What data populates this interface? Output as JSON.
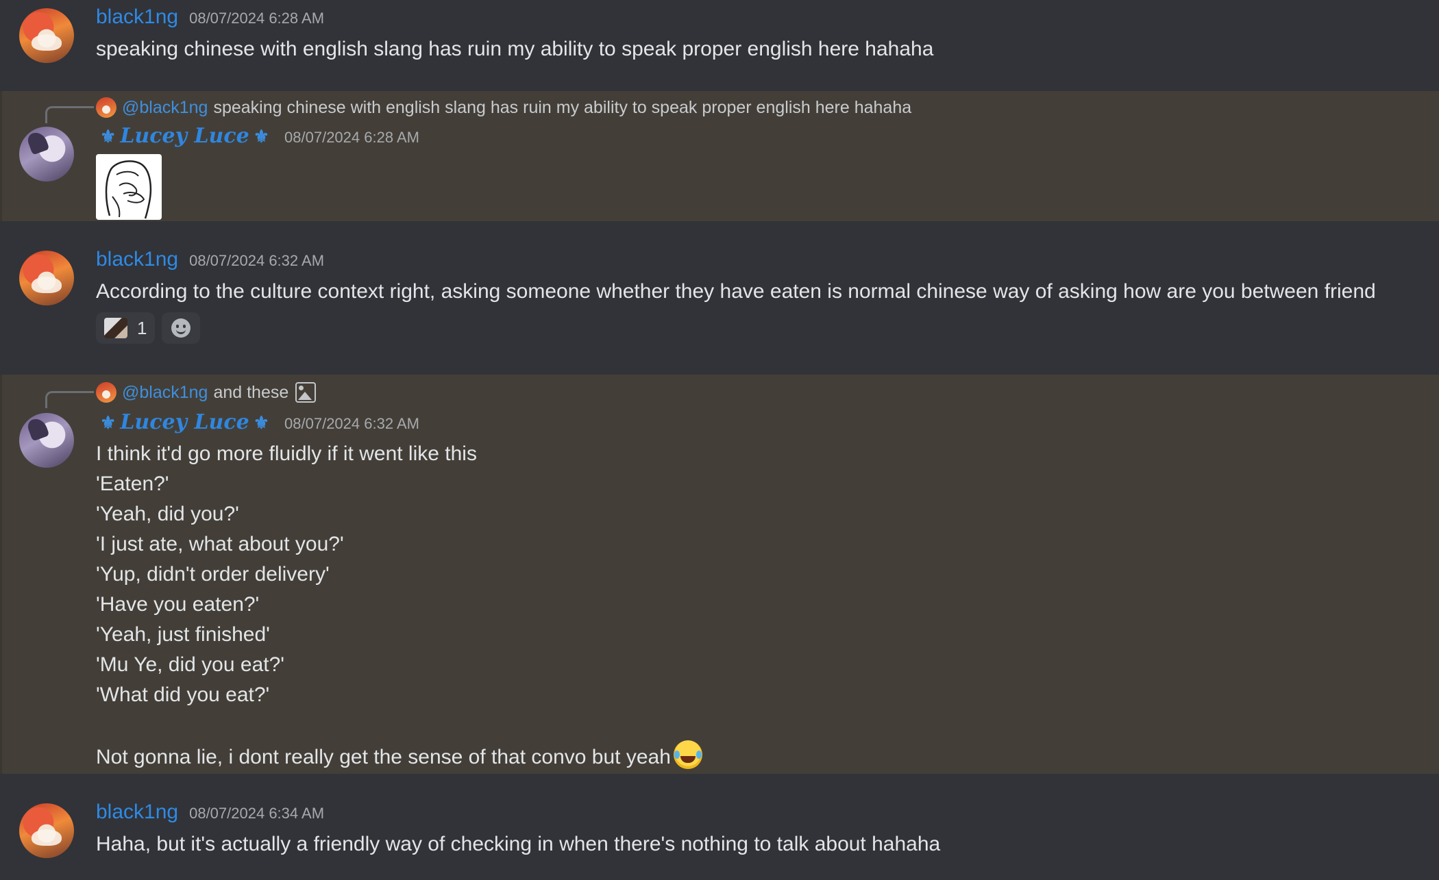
{
  "messages": [
    {
      "author": "black1ng",
      "timestamp": "08/07/2024 6:28 AM",
      "text": "speaking chinese with english slang has ruin my ability to speak proper english here hahaha"
    },
    {
      "author": "Lucey Luce",
      "author_decor": "⚜",
      "timestamp": "08/07/2024 6:28 AM",
      "reply": {
        "user": "@black1ng",
        "text": "speaking chinese with english slang has ruin my ability to speak proper english here hahaha"
      },
      "attachment": "sketch-image"
    },
    {
      "author": "black1ng",
      "timestamp": "08/07/2024 6:32 AM",
      "text": "According to the culture context right, asking someone whether they have eaten is normal chinese way of asking how are you between friend",
      "reactions": [
        {
          "emoji": "custom-emoji",
          "count": "1"
        }
      ]
    },
    {
      "author": "Lucey Luce",
      "author_decor": "⚜",
      "timestamp": "08/07/2024 6:32 AM",
      "reply": {
        "user": "@black1ng",
        "text": "and these",
        "icon": "image-icon"
      },
      "lines": [
        "I think it'd go more fluidly if it went like this",
        "'Eaten?'",
        "'Yeah, did you?'",
        "'I just ate, what about you?'",
        "'Yup, didn't order delivery'",
        "'Have you eaten?'",
        "'Yeah, just finished'",
        "'Mu Ye, did you eat?'",
        "'What did you eat?'",
        "",
        "Not gonna lie, i dont really get the sense of that convo but yeah"
      ],
      "trailing_emoji": "joy-emoji"
    },
    {
      "author": "black1ng",
      "timestamp": "08/07/2024 6:34 AM",
      "text": "Haha, but it's actually a friendly way of checking in when there's nothing to talk about hahaha"
    }
  ],
  "colors": {
    "background": "#313338",
    "mention_highlight": "#433f38",
    "username_blue": "#2f8ae6",
    "timestamp_gray": "#a7a9ae"
  }
}
